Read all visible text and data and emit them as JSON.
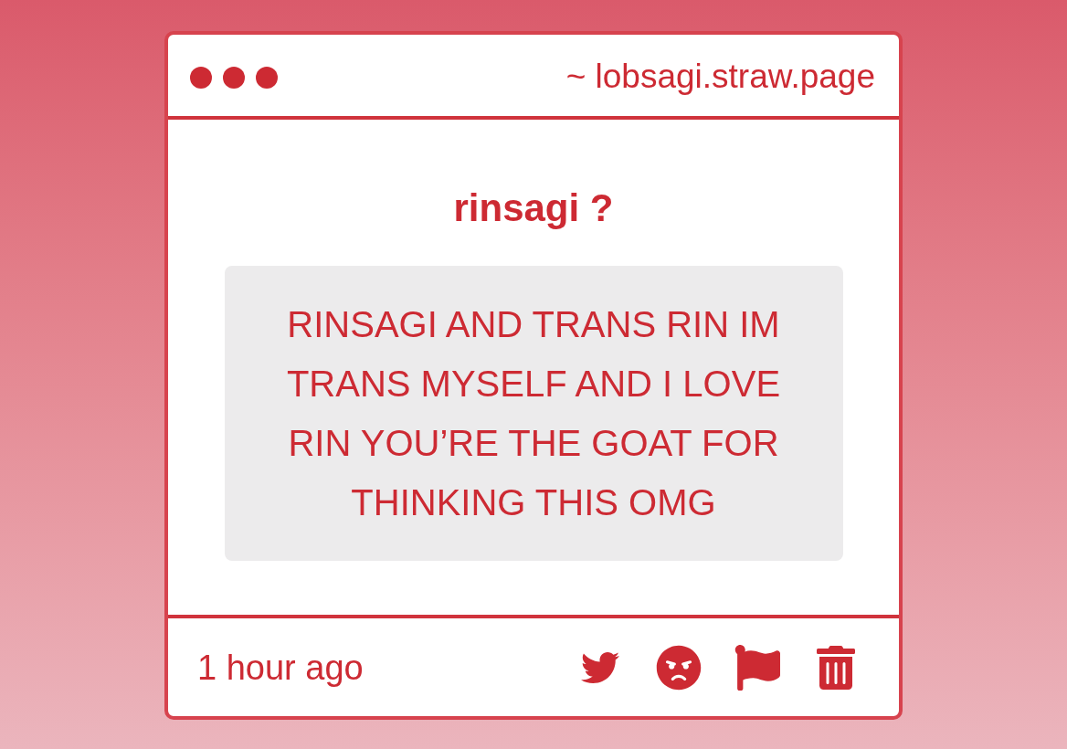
{
  "window": {
    "url": "~ lobsagi.straw.page"
  },
  "question": {
    "title": "rinsagi ?",
    "message": "RINSAGI AND TRANS RIN IM TRANS MYSELF AND I LOVE RIN YOU’RE THE GOAT FOR THINKING THIS OMG"
  },
  "footer": {
    "time": "1 hour ago"
  }
}
